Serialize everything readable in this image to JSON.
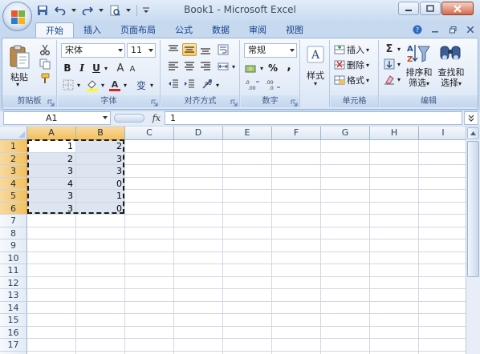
{
  "window": {
    "title": "Book1 - Microsoft Excel"
  },
  "ribbon": {
    "tabs": [
      "开始",
      "插入",
      "页面布局",
      "公式",
      "数据",
      "审阅",
      "视图"
    ],
    "clipboard": {
      "paste_label": "粘贴",
      "group_label": "剪贴板"
    },
    "font": {
      "font_name": "宋体",
      "font_size": "11",
      "group_label": "字体",
      "bold": "B",
      "italic": "I",
      "underline": "U",
      "grow": "A",
      "shrink": "A",
      "phonetic": "变"
    },
    "alignment": {
      "group_label": "对齐方式"
    },
    "number": {
      "format": "常规",
      "percent": "%",
      "comma": ",",
      "group_label": "数字"
    },
    "styles": {
      "label": "样式"
    },
    "cells": {
      "insert": "插入",
      "delete": "删除",
      "format": "格式",
      "group_label": "单元格"
    },
    "editing": {
      "sort_filter": "排序和",
      "sort_filter2": "筛选",
      "find_select": "查找和",
      "find_select2": "选择",
      "group_label": "编辑",
      "sigma": "Σ"
    }
  },
  "formula_bar": {
    "name_box": "A1",
    "fx": "fx",
    "formula": "1"
  },
  "sheet": {
    "columns": [
      "A",
      "B",
      "C",
      "D",
      "E",
      "F",
      "G",
      "H",
      "I"
    ],
    "rows": [
      "1",
      "2",
      "3",
      "4",
      "5",
      "6",
      "7",
      "8",
      "9",
      "10",
      "11",
      "12",
      "13",
      "14",
      "15",
      "16",
      "17",
      "18"
    ],
    "data": [
      [
        "1",
        "2"
      ],
      [
        "2",
        "3"
      ],
      [
        "3",
        "3"
      ],
      [
        "4",
        "0"
      ],
      [
        "3",
        "1"
      ],
      [
        "3",
        "0"
      ]
    ],
    "selected_columns": [
      "A",
      "B"
    ],
    "selected_rows": 6
  },
  "colors": {
    "accent": "#15428b",
    "selection_header": "#f1c15f",
    "selection_fill": "#dde5f1"
  }
}
